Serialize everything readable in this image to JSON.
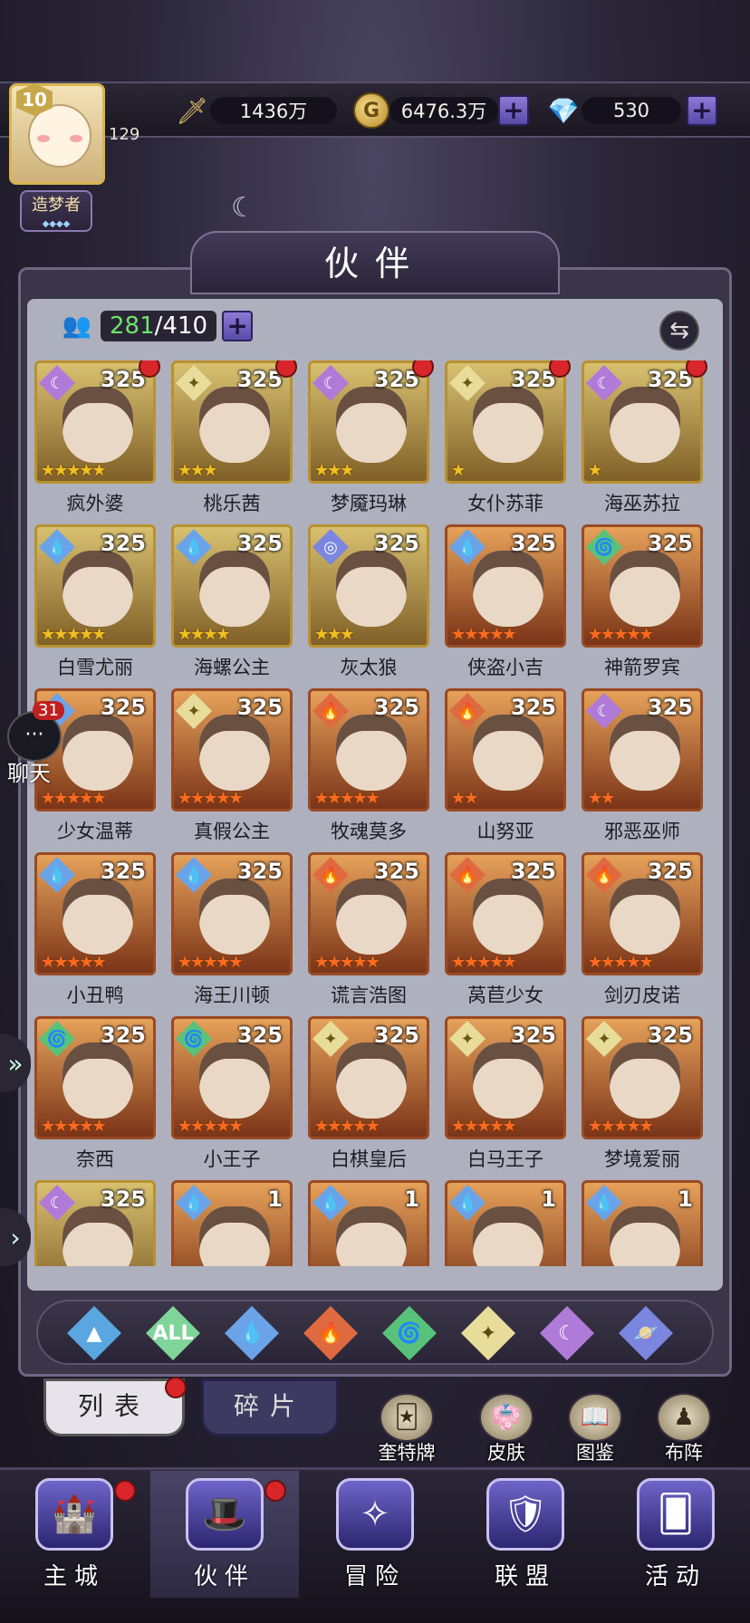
{
  "player": {
    "level": "10",
    "exp": "129",
    "title": "造梦者",
    "title_stars": "◆◆◆◆"
  },
  "resources": {
    "power": "1436万",
    "gold": "6476.3万",
    "gems": "530"
  },
  "header": {
    "title": "伙伴"
  },
  "roster": {
    "owned": "281",
    "capacity": "410"
  },
  "chat": {
    "count": "31",
    "label": "聊天"
  },
  "heroes": [
    {
      "name": "疯外婆",
      "level": "325",
      "element": "dark",
      "stars": "★★★★★",
      "frame": "gold",
      "dot": true
    },
    {
      "name": "桃乐茜",
      "level": "325",
      "element": "light",
      "stars": "★★★",
      "frame": "gold",
      "dot": true
    },
    {
      "name": "梦魇玛琳",
      "level": "325",
      "element": "dark",
      "stars": "★★★",
      "frame": "gold",
      "dot": true
    },
    {
      "name": "女仆苏菲",
      "level": "325",
      "element": "light",
      "stars": "★",
      "frame": "gold",
      "dot": true
    },
    {
      "name": "海巫苏拉",
      "level": "325",
      "element": "dark",
      "stars": "★",
      "frame": "gold",
      "dot": true
    },
    {
      "name": "白雪尤丽",
      "level": "325",
      "element": "water",
      "stars": "★★★★★",
      "frame": "gold",
      "dot": false
    },
    {
      "name": "海螺公主",
      "level": "325",
      "element": "water",
      "stars": "★★★★",
      "frame": "gold",
      "dot": false
    },
    {
      "name": "灰太狼",
      "level": "325",
      "element": "orbit",
      "stars": "★★★",
      "frame": "gold",
      "dot": false
    },
    {
      "name": "侠盗小吉",
      "level": "325",
      "element": "water",
      "stars": "★★★★★",
      "frame": "orange",
      "dot": false
    },
    {
      "name": "神箭罗宾",
      "level": "325",
      "element": "wind",
      "stars": "★★★★★",
      "frame": "orange",
      "dot": false
    },
    {
      "name": "少女温蒂",
      "level": "325",
      "element": "water",
      "stars": "★★★★★",
      "frame": "orange",
      "dot": false
    },
    {
      "name": "真假公主",
      "level": "325",
      "element": "light",
      "stars": "★★★★★",
      "frame": "orange",
      "dot": false
    },
    {
      "name": "牧魂莫多",
      "level": "325",
      "element": "fire",
      "stars": "★★★★★",
      "frame": "orange",
      "dot": false
    },
    {
      "name": "山努亚",
      "level": "325",
      "element": "fire",
      "stars": "★★",
      "frame": "orange",
      "dot": false
    },
    {
      "name": "邪恶巫师",
      "level": "325",
      "element": "dark",
      "stars": "★★",
      "frame": "orange",
      "dot": false
    },
    {
      "name": "小丑鸭",
      "level": "325",
      "element": "water",
      "stars": "★★★★★",
      "frame": "orange",
      "dot": false
    },
    {
      "name": "海王川顿",
      "level": "325",
      "element": "water",
      "stars": "★★★★★",
      "frame": "orange",
      "dot": false
    },
    {
      "name": "谎言浩图",
      "level": "325",
      "element": "fire",
      "stars": "★★★★★",
      "frame": "orange",
      "dot": false
    },
    {
      "name": "莴苣少女",
      "level": "325",
      "element": "fire",
      "stars": "★★★★★",
      "frame": "orange",
      "dot": false
    },
    {
      "name": "剑刃皮诺",
      "level": "325",
      "element": "fire",
      "stars": "★★★★★",
      "frame": "orange",
      "dot": false
    },
    {
      "name": "奈西",
      "level": "325",
      "element": "wind",
      "stars": "★★★★★",
      "frame": "orange",
      "dot": false
    },
    {
      "name": "小王子",
      "level": "325",
      "element": "wind",
      "stars": "★★★★★",
      "frame": "orange",
      "dot": false
    },
    {
      "name": "白棋皇后",
      "level": "325",
      "element": "light",
      "stars": "★★★★★",
      "frame": "orange",
      "dot": false
    },
    {
      "name": "白马王子",
      "level": "325",
      "element": "light",
      "stars": "★★★★★",
      "frame": "orange",
      "dot": false
    },
    {
      "name": "梦境爱丽",
      "level": "325",
      "element": "light",
      "stars": "★★★★★",
      "frame": "orange",
      "dot": false
    },
    {
      "name": "",
      "level": "325",
      "element": "dark",
      "stars": "",
      "frame": "gold",
      "dot": false
    },
    {
      "name": "",
      "level": "1",
      "element": "water",
      "stars": "",
      "frame": "orange",
      "dot": false
    },
    {
      "name": "",
      "level": "1",
      "element": "water",
      "stars": "",
      "frame": "orange",
      "dot": false
    },
    {
      "name": "",
      "level": "1",
      "element": "water",
      "stars": "",
      "frame": "orange",
      "dot": false
    },
    {
      "name": "",
      "level": "1",
      "element": "water",
      "stars": "",
      "frame": "orange",
      "dot": false
    }
  ],
  "filters": [
    {
      "id": "default",
      "label": "",
      "icon": "chevron-up-icon",
      "color": "#5aa6e0"
    },
    {
      "id": "all",
      "label": "ALL",
      "icon": "all-icon",
      "color": "#7fd49a"
    },
    {
      "id": "water",
      "label": "💧",
      "icon": "water-icon",
      "color": "#6aa3e8"
    },
    {
      "id": "fire",
      "label": "🔥",
      "icon": "fire-icon",
      "color": "#e06a40"
    },
    {
      "id": "wind",
      "label": "🌀",
      "icon": "wind-icon",
      "color": "#58c27a"
    },
    {
      "id": "light",
      "label": "✦",
      "icon": "light-icon",
      "color": "#e8dc9a"
    },
    {
      "id": "dark",
      "label": "☾",
      "icon": "dark-icon",
      "color": "#b07ad8"
    },
    {
      "id": "orbit",
      "label": "🪐",
      "icon": "orbit-icon",
      "color": "#7a86e0"
    }
  ],
  "tabs": {
    "list": "列表",
    "fragments": "碎片"
  },
  "quick_actions": [
    {
      "label": "奎特牌",
      "icon": "cards-icon"
    },
    {
      "label": "皮肤",
      "icon": "skin-icon"
    },
    {
      "label": "图鉴",
      "icon": "book-icon"
    },
    {
      "label": "布阵",
      "icon": "formation-icon"
    }
  ],
  "nav": [
    {
      "label": "主城",
      "icon": "castle-icon",
      "dot": true
    },
    {
      "label": "伙伴",
      "icon": "hat-icon",
      "dot": true
    },
    {
      "label": "冒险",
      "icon": "compass-icon",
      "dot": false
    },
    {
      "label": "联盟",
      "icon": "shield-icon",
      "dot": false
    },
    {
      "label": "活动",
      "icon": "cards-icon",
      "dot": false
    }
  ]
}
